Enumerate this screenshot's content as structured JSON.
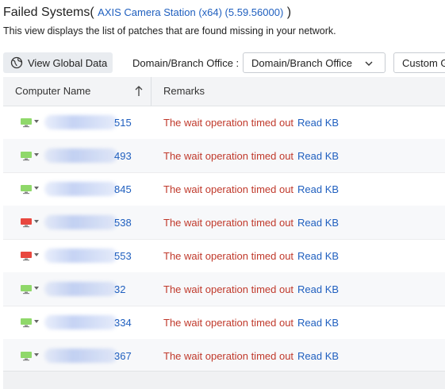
{
  "header": {
    "title_prefix": "Failed Systems(",
    "title_link": "AXIS Camera Station (x64) (5.59.56000)",
    "title_suffix": ")",
    "description": "This view displays the list of patches that are found missing in your network."
  },
  "toolbar": {
    "global_button": "View Global Data",
    "domain_label": "Domain/Branch Office :",
    "domain_value": "Domain/Branch Office",
    "custom_button": "Custom G"
  },
  "table": {
    "columns": [
      "Computer Name",
      "Remarks"
    ],
    "rows": [
      {
        "suffix": "515",
        "status": "ok",
        "remark": "The wait operation timed out",
        "link": "Read KB"
      },
      {
        "suffix": "493",
        "status": "ok",
        "remark": "The wait operation timed out",
        "link": "Read KB"
      },
      {
        "suffix": "845",
        "status": "ok",
        "remark": "The wait operation timed out",
        "link": "Read KB"
      },
      {
        "suffix": "538",
        "status": "down",
        "remark": "The wait operation timed out",
        "link": "Read KB"
      },
      {
        "suffix": "553",
        "status": "down",
        "remark": "The wait operation timed out",
        "link": "Read KB"
      },
      {
        "suffix": "32",
        "status": "ok",
        "remark": "The wait operation timed out",
        "link": "Read KB"
      },
      {
        "suffix": "334",
        "status": "ok",
        "remark": "The wait operation timed out",
        "link": "Read KB"
      },
      {
        "suffix": "367",
        "status": "ok",
        "remark": "The wait operation timed out",
        "link": "Read KB"
      }
    ]
  },
  "colors": {
    "ok": "#8fd86a",
    "down": "#e8473f",
    "link": "#1f5fbf",
    "error": "#c0392b"
  }
}
